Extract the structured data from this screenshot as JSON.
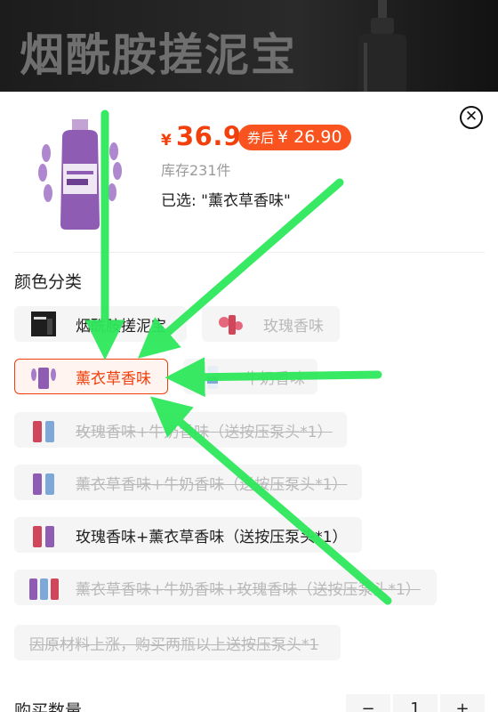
{
  "banner": {
    "title": "烟酰胺搓泥宝"
  },
  "product": {
    "price_symbol": "¥",
    "price": "36.9",
    "coupon_label": "券后",
    "coupon_price": "¥ 26.90",
    "stock": "库存231件",
    "selected": "已选: \"薰衣草香味\""
  },
  "section": {
    "title": "颜色分类"
  },
  "options": [
    {
      "label": "烟酰胺搓泥宝",
      "state": "normal"
    },
    {
      "label": "玫瑰香味",
      "state": "disabled"
    },
    {
      "label": "薰衣草香味",
      "state": "active"
    },
    {
      "label": "牛奶香味",
      "state": "disabled"
    },
    {
      "label": "玫瑰香味+牛奶香味（送按压泵头*1）",
      "state": "disabled"
    },
    {
      "label": "薰衣草香味+牛奶香味（送按压泵头*1）",
      "state": "disabled"
    },
    {
      "label": "玫瑰香味+薰衣草香味（送按压泵头*1）",
      "state": "normal"
    },
    {
      "label": "薰衣草香味+牛奶香味+玫瑰香味（送按压泵头*1）",
      "state": "disabled"
    },
    {
      "label": "因原材料上涨，购买两瓶以上送按压泵头*1",
      "state": "disabled"
    }
  ],
  "quantity": {
    "label": "购买数量",
    "value": "1",
    "minus": "−",
    "plus": "+"
  },
  "colors": {
    "accent": "#f2400d",
    "arrow": "#2ee85c"
  }
}
